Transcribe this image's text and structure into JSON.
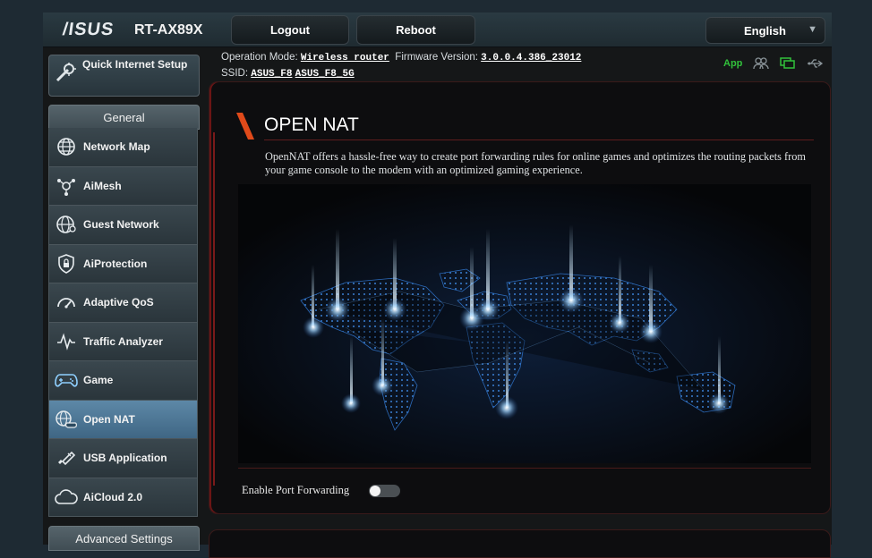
{
  "header": {
    "brand": "/ISUS",
    "model": "RT-AX89X",
    "logout_label": "Logout",
    "reboot_label": "Reboot",
    "language": "English"
  },
  "info": {
    "operation_mode_label": "Operation Mode:",
    "operation_mode_value": "Wireless router",
    "firmware_label": "Firmware Version:",
    "firmware_value": "3.0.0.4.386_23012",
    "ssid_label": "SSID:",
    "ssid_1": "ASUS_F8",
    "ssid_2": "ASUS_F8_5G",
    "app_label": "App"
  },
  "sidebar": {
    "quick_setup_label": "Quick Internet Setup",
    "general_label": "General",
    "advanced_label": "Advanced Settings",
    "items": [
      {
        "label": "Network Map",
        "icon": "globe-network-icon"
      },
      {
        "label": "AiMesh",
        "icon": "aimesh-icon"
      },
      {
        "label": "Guest Network",
        "icon": "guest-globe-icon"
      },
      {
        "label": "AiProtection",
        "icon": "shield-lock-icon"
      },
      {
        "label": "Adaptive QoS",
        "icon": "gauge-icon"
      },
      {
        "label": "Traffic Analyzer",
        "icon": "pulse-icon"
      },
      {
        "label": "Game",
        "icon": "gamepad-icon"
      },
      {
        "label": "Open NAT",
        "icon": "open-nat-icon"
      },
      {
        "label": "USB Application",
        "icon": "usb-icon"
      },
      {
        "label": "AiCloud 2.0",
        "icon": "cloud-icon"
      }
    ]
  },
  "main": {
    "title": "OPEN NAT",
    "description": "OpenNAT offers a hassle-free way to create port forwarding rules for online games and optimizes the routing packets from your game console to the modem with an optimized gaming experience.",
    "port_forwarding_label": "Enable Port Forwarding",
    "port_forwarding_enabled": false
  },
  "colors": {
    "accent_red": "#e04a1a",
    "active_item": "#4f7a99",
    "app_green": "#31c13b"
  }
}
